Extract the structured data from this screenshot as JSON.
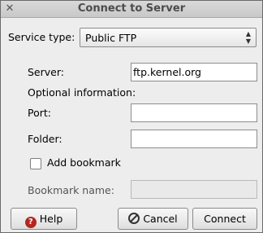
{
  "window": {
    "title": "Connect to Server"
  },
  "service": {
    "label": "Service type:",
    "value": "Public FTP"
  },
  "server": {
    "label": "Server:",
    "value": "ftp.kernel.org"
  },
  "optional": {
    "label": "Optional information:"
  },
  "port": {
    "label": "Port:",
    "value": ""
  },
  "folder": {
    "label": "Folder:",
    "value": ""
  },
  "bookmark": {
    "checkbox_label": "Add bookmark",
    "name_label": "Bookmark name:",
    "name_value": ""
  },
  "buttons": {
    "help": "Help",
    "cancel": "Cancel",
    "connect": "Connect"
  }
}
